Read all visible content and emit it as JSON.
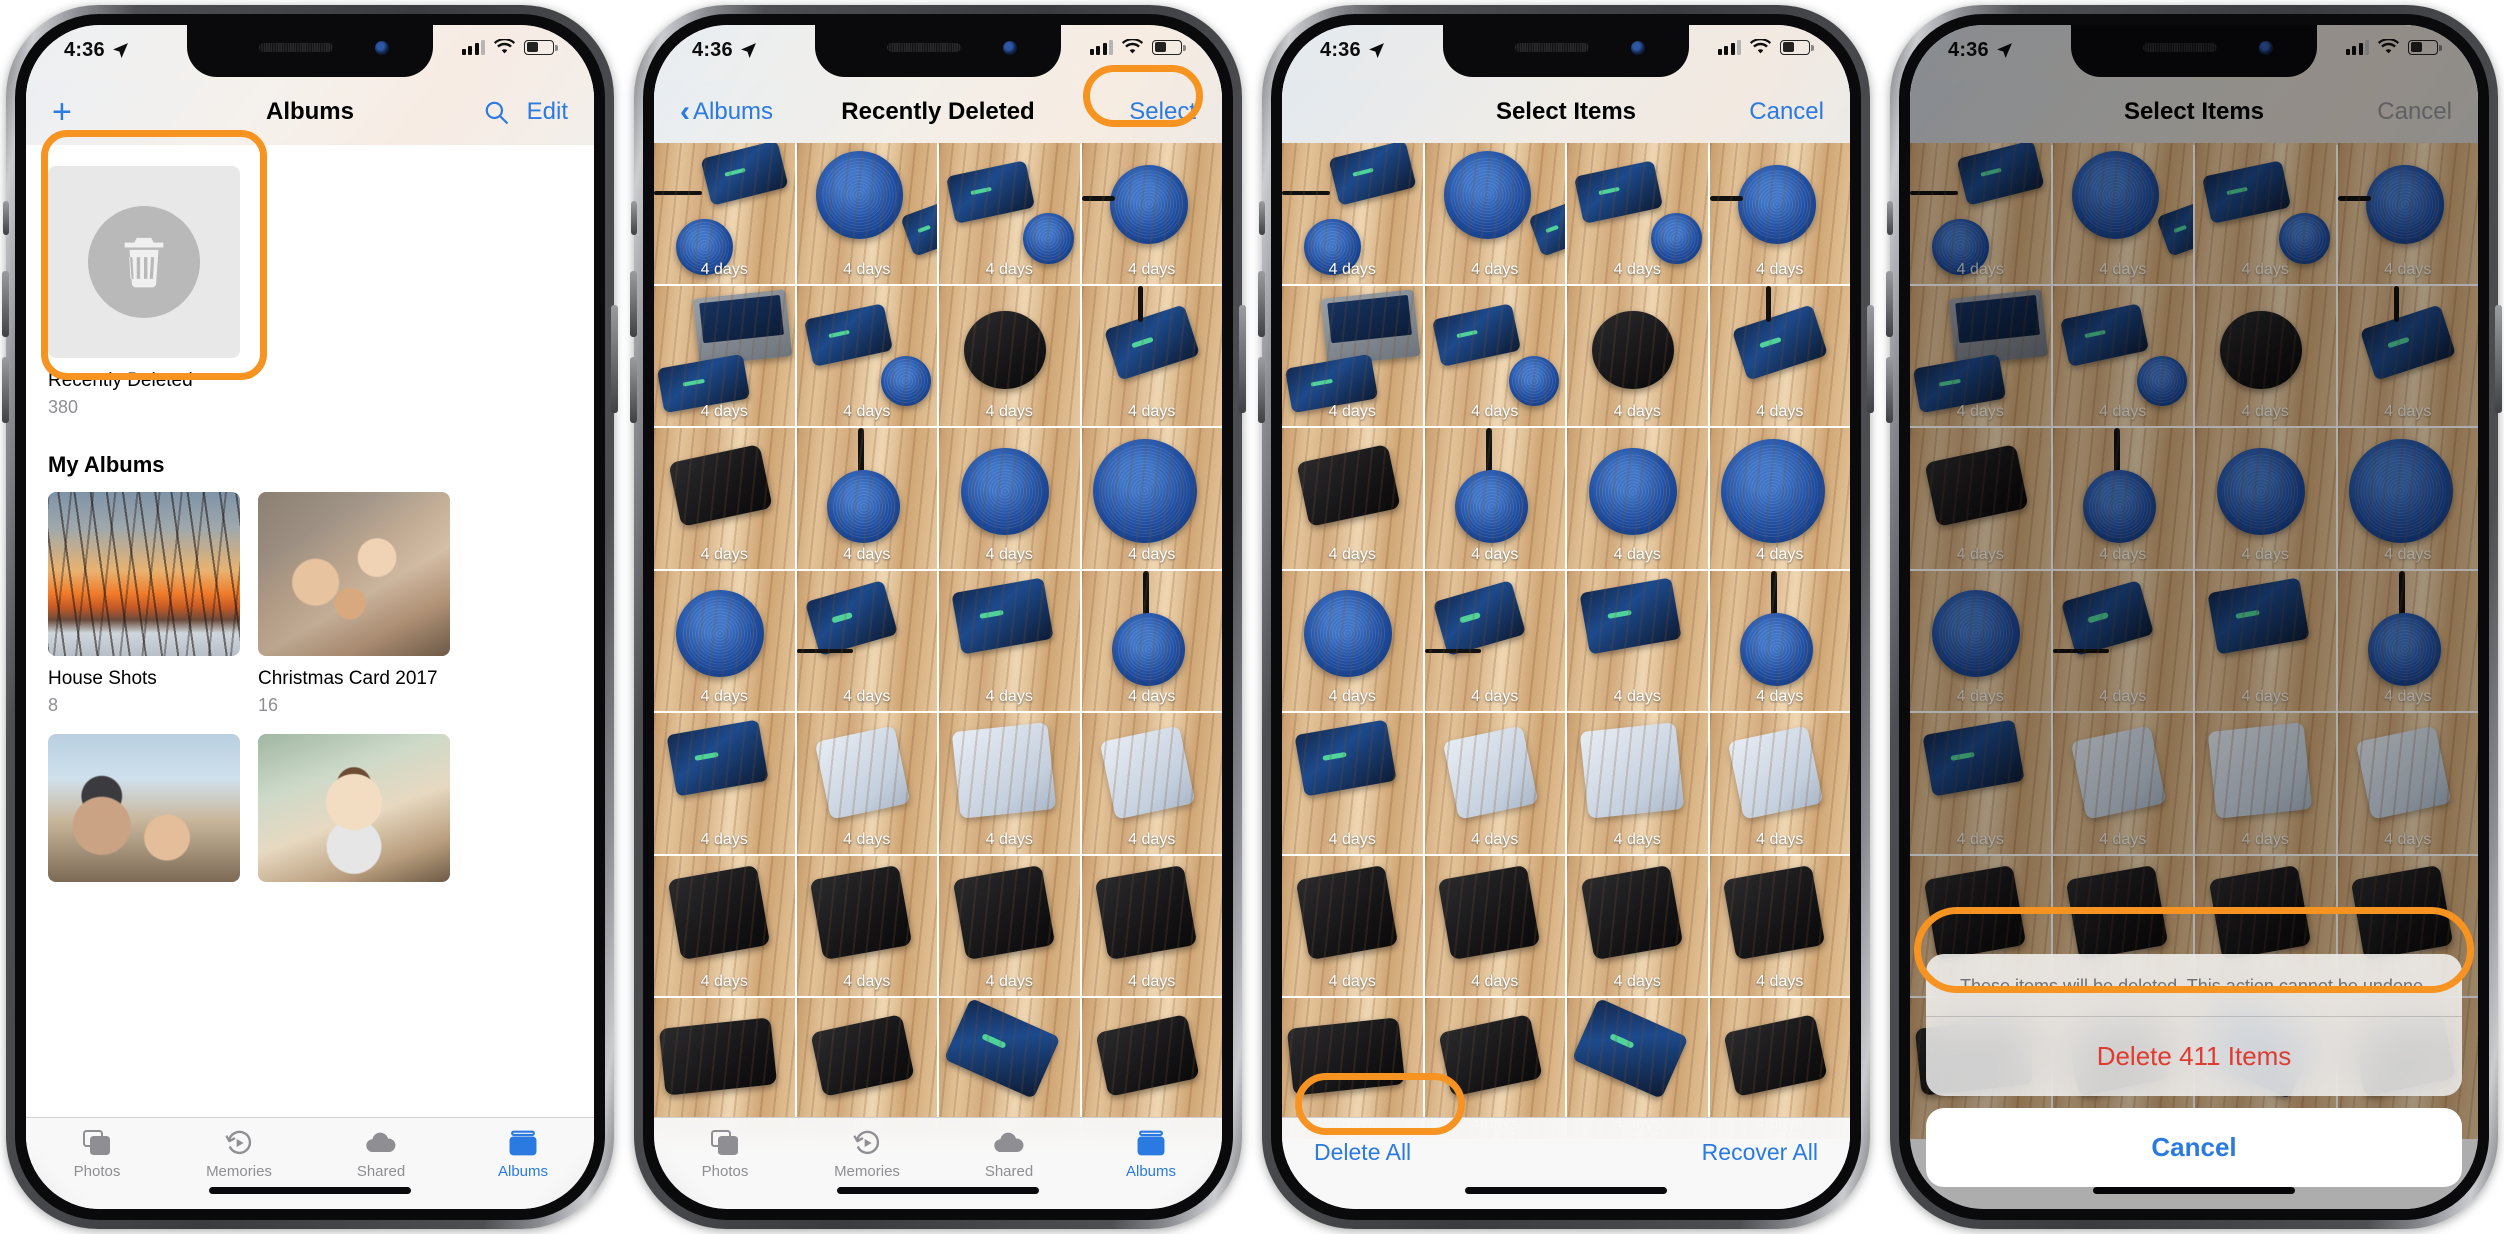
{
  "status_bar": {
    "time": "4:36",
    "location_icon": "location-arrow-icon",
    "cellular_icon": "cellular-bars-icon",
    "wifi_icon": "wifi-icon",
    "battery_icon": "battery-icon"
  },
  "screens": [
    {
      "id": "albums",
      "nav": {
        "add_label": "+",
        "title": "Albums",
        "search_icon": "search-icon",
        "edit_label": "Edit"
      },
      "recently_deleted": {
        "icon": "trash-icon",
        "name": "Recently Deleted",
        "count": "380"
      },
      "section_title": "My Albums",
      "albums": [
        {
          "name": "House Shots",
          "count": "8"
        },
        {
          "name": "Christmas Card 2017",
          "count": "16"
        }
      ],
      "tabs": [
        {
          "label": "Photos",
          "icon": "photos-icon",
          "active": false
        },
        {
          "label": "Memories",
          "icon": "memories-icon",
          "active": false
        },
        {
          "label": "Shared",
          "icon": "shared-cloud-icon",
          "active": false
        },
        {
          "label": "Albums",
          "icon": "albums-icon",
          "active": true
        }
      ]
    },
    {
      "id": "recently-deleted",
      "nav": {
        "back_label": "Albums",
        "title": "Recently Deleted",
        "action_label": "Select"
      },
      "photo_caption": "4 days",
      "tabs": [
        {
          "label": "Photos",
          "icon": "photos-icon",
          "active": false
        },
        {
          "label": "Memories",
          "icon": "memories-icon",
          "active": false
        },
        {
          "label": "Shared",
          "icon": "shared-cloud-icon",
          "active": false
        },
        {
          "label": "Albums",
          "icon": "albums-icon",
          "active": true
        }
      ]
    },
    {
      "id": "select-items",
      "nav": {
        "title": "Select Items",
        "action_label": "Cancel"
      },
      "photo_caption": "4 days",
      "toolbar": {
        "delete_all_label": "Delete All",
        "recover_all_label": "Recover All"
      }
    },
    {
      "id": "confirm-delete",
      "nav": {
        "title": "Select Items",
        "action_label": "Cancel"
      },
      "photo_caption": "4 days",
      "action_sheet": {
        "message": "These items will be deleted. This action cannot be undone.",
        "destructive_label": "Delete 411 Items",
        "cancel_label": "Cancel"
      }
    }
  ],
  "colors": {
    "highlight": "#f79421",
    "ios_blue": "#2a7ae2",
    "destructive_red": "#e03b30",
    "secondary_gray": "#8e8e93"
  }
}
